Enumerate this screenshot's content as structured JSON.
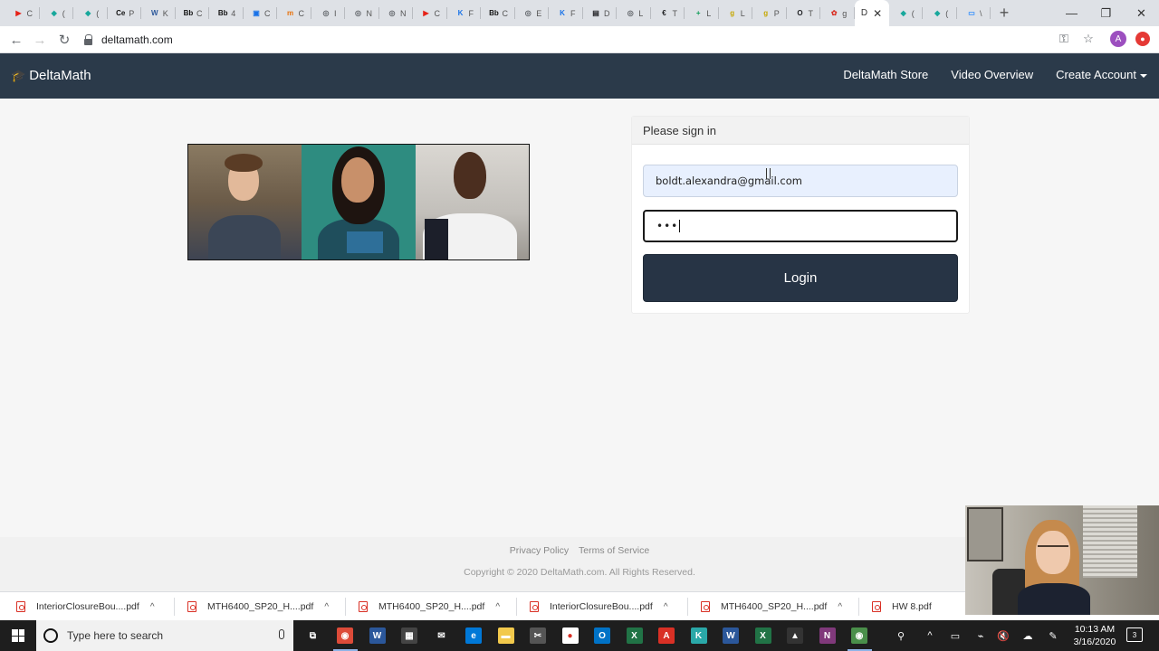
{
  "browser": {
    "tabs": [
      {
        "glyph": "▶",
        "color": "#e62117",
        "letter": "C"
      },
      {
        "glyph": "◆",
        "color": "#18a89c",
        "letter": "("
      },
      {
        "glyph": "◆",
        "color": "#18a89c",
        "letter": "("
      },
      {
        "glyph": "Ce",
        "color": "#ffffff",
        "letter": "P"
      },
      {
        "glyph": "W",
        "color": "#2b579a",
        "letter": "K"
      },
      {
        "glyph": "Bb",
        "color": "#ffffff",
        "letter": "C"
      },
      {
        "glyph": "Bb",
        "color": "#ffffff",
        "letter": "4"
      },
      {
        "glyph": "▣",
        "color": "#1a73e8",
        "letter": "C"
      },
      {
        "glyph": "m",
        "color": "#e8710a",
        "letter": "C"
      },
      {
        "glyph": "◎",
        "color": "#5f6368",
        "letter": "I"
      },
      {
        "glyph": "◎",
        "color": "#5f6368",
        "letter": "N"
      },
      {
        "glyph": "◎",
        "color": "#5f6368",
        "letter": "N"
      },
      {
        "glyph": "▶",
        "color": "#e62117",
        "letter": "C"
      },
      {
        "glyph": "K",
        "color": "#1a73e8",
        "letter": "F"
      },
      {
        "glyph": "Bb",
        "color": "#ffffff",
        "letter": "C"
      },
      {
        "glyph": "◎",
        "color": "#5f6368",
        "letter": "E"
      },
      {
        "glyph": "K",
        "color": "#1a73e8",
        "letter": "F"
      },
      {
        "glyph": "▤",
        "color": "#202124",
        "letter": "D"
      },
      {
        "glyph": "◎",
        "color": "#5f6368",
        "letter": "L"
      },
      {
        "glyph": "€",
        "color": "#202124",
        "letter": "T"
      },
      {
        "glyph": "+",
        "color": "#0f9d58",
        "letter": "L"
      },
      {
        "glyph": "g",
        "color": "#c6a700",
        "letter": "L"
      },
      {
        "glyph": "g",
        "color": "#c6a700",
        "letter": "P"
      },
      {
        "glyph": "O",
        "color": "#202124",
        "letter": "T"
      },
      {
        "glyph": "✿",
        "color": "#d93025",
        "letter": "g"
      }
    ],
    "active_tab": {
      "label": "D",
      "close": "✕"
    },
    "tabs_after": [
      {
        "glyph": "◆",
        "color": "#18a89c",
        "letter": "("
      },
      {
        "glyph": "◆",
        "color": "#18a89c",
        "letter": "("
      },
      {
        "glyph": "▭",
        "color": "#2d8cff",
        "letter": "\\"
      }
    ],
    "new_tab": "+",
    "window_controls": {
      "minimize": "—",
      "restore": "❐",
      "close": "✕"
    },
    "back": "←",
    "forward": "→",
    "reload": "↻",
    "url": "deltamath.com",
    "key_icon": "⚿",
    "star_icon": "☆",
    "profile_initial": "A",
    "extension_glyph": "●"
  },
  "navbar": {
    "brand_icon": "🎓",
    "brand": "DeltaMath",
    "links": [
      "DeltaMath Store",
      "Video Overview",
      "Create Account"
    ]
  },
  "login": {
    "heading": "Please sign in",
    "email": "boldt.alexandra@gmail.com",
    "password_mask": "•••",
    "button": "Login"
  },
  "footer": {
    "privacy": "Privacy Policy",
    "terms": "Terms of Service",
    "copyright": "Copyright © 2020 DeltaMath.com. All Rights Reserved."
  },
  "downloads": [
    {
      "name": "InteriorClosureBou....pdf",
      "caret": "^"
    },
    {
      "name": "MTH6400_SP20_H....pdf",
      "caret": "^"
    },
    {
      "name": "MTH6400_SP20_H....pdf",
      "caret": "^"
    },
    {
      "name": "InteriorClosureBou....pdf",
      "caret": "^"
    },
    {
      "name": "MTH6400_SP20_H....pdf",
      "caret": "^"
    },
    {
      "name": "HW 8.pdf",
      "caret": ""
    }
  ],
  "taskbar": {
    "search_placeholder": "Type here to search",
    "apps": [
      {
        "name": "task-view",
        "glyph": "⧉",
        "color": "#1e1e1e"
      },
      {
        "name": "chrome",
        "glyph": "◉",
        "color": "#dd4b39",
        "active": true
      },
      {
        "name": "word",
        "glyph": "W",
        "color": "#2b579a"
      },
      {
        "name": "calculator",
        "glyph": "▦",
        "color": "#444444"
      },
      {
        "name": "mail",
        "glyph": "✉",
        "color": "#1e1e1e"
      },
      {
        "name": "edge",
        "glyph": "e",
        "color": "#0078d7"
      },
      {
        "name": "file-explorer",
        "glyph": "▬",
        "color": "#f2c94c"
      },
      {
        "name": "snipping",
        "glyph": "✂",
        "color": "#555555"
      },
      {
        "name": "recorder",
        "glyph": "●",
        "color": "#ffffff"
      },
      {
        "name": "outlook",
        "glyph": "O",
        "color": "#0072c6"
      },
      {
        "name": "excel",
        "glyph": "X",
        "color": "#217346"
      },
      {
        "name": "acrobat",
        "glyph": "A",
        "color": "#d93025"
      },
      {
        "name": "geogebra",
        "glyph": "K",
        "color": "#2aa8a8"
      },
      {
        "name": "word-2",
        "glyph": "W",
        "color": "#2b579a"
      },
      {
        "name": "excel-2",
        "glyph": "X",
        "color": "#217346"
      },
      {
        "name": "photos",
        "glyph": "▲",
        "color": "#333333"
      },
      {
        "name": "onenote",
        "glyph": "N",
        "color": "#80397b"
      },
      {
        "name": "chrome-2",
        "glyph": "◉",
        "color": "#4a8f4a",
        "active": true
      }
    ],
    "tray_icons": [
      "⚲",
      "^",
      "▭",
      "⌁",
      "🔇",
      "☁",
      "✎"
    ],
    "time": "10:13 AM",
    "date": "3/16/2020",
    "notifications": "3"
  }
}
